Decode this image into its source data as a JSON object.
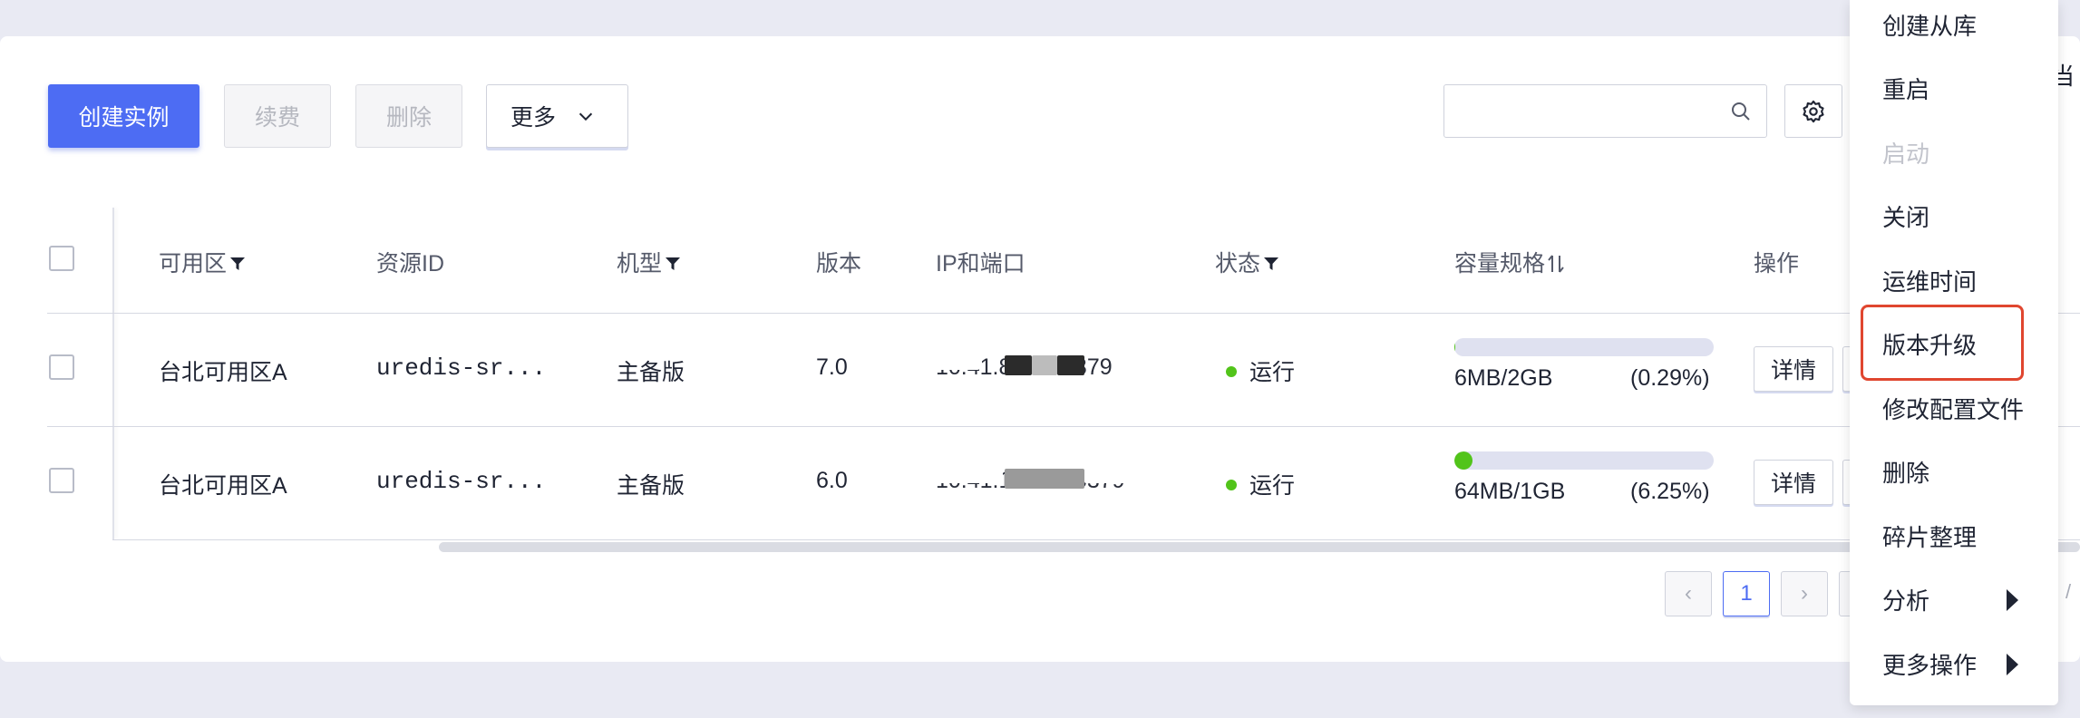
{
  "toolbar": {
    "create_label": "创建实例",
    "renew_label": "续费",
    "delete_label": "删除",
    "more_label": "更多",
    "search_placeholder": "",
    "search_value": "",
    "search_icon": "search-icon",
    "settings_icon": "gear-icon",
    "edge_text": "当"
  },
  "table": {
    "headers": {
      "zone": "可用区",
      "resource_id": "资源ID",
      "model": "机型",
      "version": "版本",
      "ip_port": "IP和端口",
      "status": "状态",
      "capacity": "容量规格",
      "actions": "操作"
    },
    "rows": [
      {
        "zone": "台北可用区A",
        "resource_id": "uredis-sr...",
        "model": "主备版",
        "version": "7.0",
        "ip_port": "10.41.84.59.6379",
        "status": "运行",
        "capacity_used": "6MB/2GB",
        "capacity_pct": "(0.29%)",
        "capacity_fraction": 0.0029,
        "action_detail": "详情"
      },
      {
        "zone": "台北可用区A",
        "resource_id": "uredis-sr...",
        "model": "主备版",
        "version": "6.0",
        "ip_port": "10.41.12.222.6379",
        "status": "运行",
        "capacity_used": "64MB/1GB",
        "capacity_pct": "(6.25%)",
        "capacity_fraction": 0.0625,
        "action_detail": "详情"
      }
    ]
  },
  "pagination": {
    "prev": "‹",
    "current": "1",
    "next": "›",
    "tail": "/"
  },
  "menu": {
    "items": [
      {
        "label": "创建从库",
        "disabled": false
      },
      {
        "label": "重启",
        "disabled": false
      },
      {
        "label": "启动",
        "disabled": true
      },
      {
        "label": "关闭",
        "disabled": false
      },
      {
        "label": "运维时间",
        "disabled": false
      },
      {
        "label": "版本升级",
        "disabled": false,
        "highlighted": true
      },
      {
        "label": "修改配置文件",
        "disabled": false
      },
      {
        "label": "删除",
        "disabled": false
      },
      {
        "label": "碎片整理",
        "disabled": false
      },
      {
        "label": "分析",
        "disabled": false,
        "submenu": true
      },
      {
        "label": "更多操作",
        "disabled": false,
        "submenu": true
      }
    ]
  },
  "colors": {
    "primary": "#4d6cf3",
    "status_running": "#52c41a",
    "highlight": "#e0462f"
  }
}
